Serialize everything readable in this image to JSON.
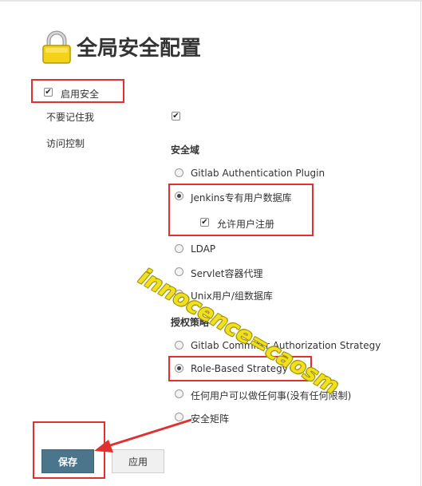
{
  "page": {
    "title": "全局安全配置"
  },
  "security": {
    "enable_label": "启用安全",
    "enable_checked": true,
    "remember_me_label": "不要记住我",
    "remember_me_checked": true,
    "access_control_label": "访问控制"
  },
  "realm": {
    "section_title": "安全域",
    "options": [
      {
        "label": "Gitlab Authentication Plugin",
        "selected": false
      },
      {
        "label": "Jenkins专有用户数据库",
        "selected": true
      },
      {
        "label": "LDAP",
        "selected": false
      },
      {
        "label": "Servlet容器代理",
        "selected": false
      },
      {
        "label": "Unix用户/组数据库",
        "selected": false
      }
    ],
    "allow_signup_label": "允许用户注册",
    "allow_signup_checked": true
  },
  "authorization": {
    "section_title": "授权策略",
    "options": [
      {
        "label": "Gitlab Commiter Authorization Strategy",
        "selected": false
      },
      {
        "label": "Role-Based Strategy",
        "selected": true
      },
      {
        "label": "任何用户可以做任何事(没有任何限制)",
        "selected": false
      },
      {
        "label": "安全矩阵",
        "selected": false
      }
    ]
  },
  "buttons": {
    "save_label": "保存",
    "apply_label": "应用"
  },
  "watermark": {
    "text": "innocence=caosm"
  },
  "colors": {
    "highlight_red": "#e03030",
    "save_button": "#4b758b",
    "watermark": "#f1e020"
  }
}
